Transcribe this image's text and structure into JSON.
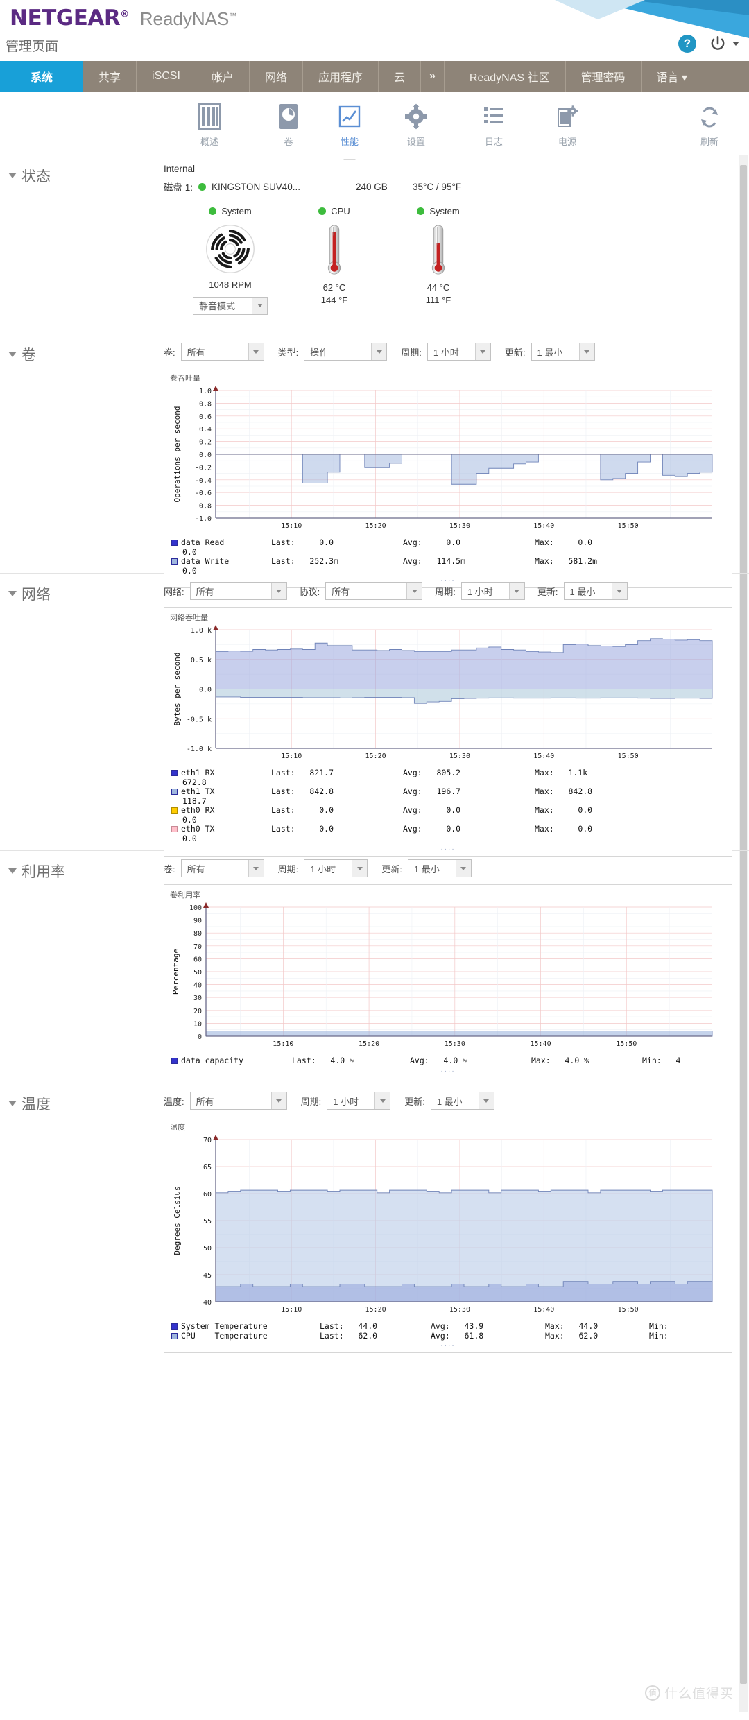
{
  "header": {
    "brand": "NETGEAR",
    "brand_mark": "®",
    "product": "ReadyNAS",
    "product_mark": "™",
    "admin_title": "管理页面",
    "help_icon": "help-icon",
    "help_label": "?",
    "power_icon": "power-icon"
  },
  "tabs": [
    {
      "label": "系统",
      "active": true
    },
    {
      "label": "共享",
      "active": false
    },
    {
      "label": "iSCSI",
      "active": false
    },
    {
      "label": "帐户",
      "active": false
    },
    {
      "label": "网络",
      "active": false
    },
    {
      "label": "应用程序",
      "active": false
    },
    {
      "label": "云",
      "active": false
    },
    {
      "label": "»",
      "active": false
    }
  ],
  "right_tabs": [
    {
      "label": "ReadyNAS 社区"
    },
    {
      "label": "管理密码"
    },
    {
      "label": "语言 ▾"
    }
  ],
  "toolbar": [
    {
      "label": "概述",
      "icon": "overview-icon",
      "active": false
    },
    {
      "label": "卷",
      "icon": "volume-icon",
      "active": false
    },
    {
      "label": "性能",
      "icon": "performance-icon",
      "active": true
    },
    {
      "label": "设置",
      "icon": "settings-gear-icon",
      "active": false
    },
    {
      "label": "日志",
      "icon": "logs-icon",
      "active": false
    },
    {
      "label": "电源",
      "icon": "power-settings-icon",
      "active": false
    },
    {
      "label": "刷新",
      "icon": "refresh-icon",
      "active": false
    }
  ],
  "status": {
    "title": "状态",
    "enclosure": "Internal",
    "disk_label": "磁盘 1:",
    "disk_model": "KINGSTON SUV40...",
    "disk_capacity": "240 GB",
    "disk_temp": "35°C / 95°F",
    "gauges": [
      {
        "name": "System",
        "type": "fan",
        "value": "1048 RPM",
        "value2": "",
        "mode": "靜音模式"
      },
      {
        "name": "CPU",
        "type": "thermo",
        "value": "62 °C",
        "value2": "144 °F"
      },
      {
        "name": "System",
        "type": "thermo",
        "value": "44 °C",
        "value2": "111 °F"
      }
    ]
  },
  "volume": {
    "title": "卷",
    "filters": [
      {
        "label": "卷:",
        "value": "所有"
      },
      {
        "label": "类型:",
        "value": "操作"
      },
      {
        "label": "周期:",
        "value": "1 小时"
      },
      {
        "label": "更新:",
        "value": "1 最小"
      }
    ],
    "panel_title": "卷吞吐量",
    "legend": [
      {
        "name": "data Read",
        "last_label": "Last:",
        "last": "0.0",
        "avg_label": "Avg:",
        "avg": "0.0",
        "max_label": "Max:",
        "max": "0.0",
        "wrap": "0.0",
        "color": "#3333cc"
      },
      {
        "name": "data Write",
        "last_label": "Last:",
        "last": "252.3m",
        "avg_label": "Avg:",
        "avg": "114.5m",
        "max_label": "Max:",
        "max": "581.2m",
        "wrap": "0.0",
        "color": "#9fb6de"
      }
    ]
  },
  "network": {
    "title": "网络",
    "filters": [
      {
        "label": "网络:",
        "value": "所有"
      },
      {
        "label": "协议:",
        "value": "所有"
      },
      {
        "label": "周期:",
        "value": "1 小时"
      },
      {
        "label": "更新:",
        "value": "1 最小"
      }
    ],
    "panel_title": "网络吞吐量",
    "legend": [
      {
        "name": "eth1 RX",
        "last_label": "Last:",
        "last": "821.7",
        "avg_label": "Avg:",
        "avg": "805.2",
        "max_label": "Max:",
        "max": "1.1k",
        "wrap": "672.8",
        "color": "#3333cc"
      },
      {
        "name": "eth1 TX",
        "last_label": "Last:",
        "last": "842.8",
        "avg_label": "Avg:",
        "avg": "196.7",
        "max_label": "Max:",
        "max": "842.8",
        "wrap": "118.7",
        "color": "#9fb6de"
      },
      {
        "name": "eth0 RX",
        "last_label": "Last:",
        "last": "0.0",
        "avg_label": "Avg:",
        "avg": "0.0",
        "max_label": "Max:",
        "max": "0.0",
        "wrap": "0.0",
        "color": "#ffcc00"
      },
      {
        "name": "eth0 TX",
        "last_label": "Last:",
        "last": "0.0",
        "avg_label": "Avg:",
        "avg": "0.0",
        "max_label": "Max:",
        "max": "0.0",
        "wrap": "0.0",
        "color": "#ffc0cb"
      }
    ]
  },
  "utilization": {
    "title": "利用率",
    "filters": [
      {
        "label": "卷:",
        "value": "所有"
      },
      {
        "label": "周期:",
        "value": "1 小时"
      },
      {
        "label": "更新:",
        "value": "1 最小"
      }
    ],
    "panel_title": "卷利用率",
    "legend": [
      {
        "name": "data capacity",
        "last_label": "Last:",
        "last": "4.0 %",
        "avg_label": "Avg:",
        "avg": "4.0 %",
        "max_label": "Max:",
        "max": "4.0 %",
        "min_label": "Min:",
        "min": "4",
        "color": "#3333cc"
      }
    ]
  },
  "temperature": {
    "title": "温度",
    "filters": [
      {
        "label": "温度:",
        "value": "所有"
      },
      {
        "label": "周期:",
        "value": "1 小时"
      },
      {
        "label": "更新:",
        "value": "1 最小"
      }
    ],
    "panel_title": "温度",
    "legend": [
      {
        "name": "System Temperature",
        "last_label": "Last:",
        "last": "44.0",
        "avg_label": "Avg:",
        "avg": "43.9",
        "max_label": "Max:",
        "max": "44.0",
        "min_label": "Min:",
        "min": "",
        "color": "#3333cc"
      },
      {
        "name": "CPU    Temperature",
        "last_label": "Last:",
        "last": "62.0",
        "avg_label": "Avg:",
        "avg": "61.8",
        "max_label": "Max:",
        "max": "62.0",
        "min_label": "Min:",
        "min": "",
        "color": "#9fb6de"
      }
    ]
  },
  "watermark": {
    "mark": "值",
    "text": "什么值得买"
  },
  "chart_data": [
    {
      "id": "volume-throughput",
      "type": "area",
      "title": "卷吞吐量",
      "xlabel": "",
      "ylabel": "Operations per second",
      "ylim": [
        -1.0,
        1.0
      ],
      "yticks": [
        "1.0",
        "0.8",
        "0.6",
        "0.4",
        "0.2",
        "0.0",
        "-0.2",
        "-0.4",
        "-0.6",
        "-0.8",
        "-1.0"
      ],
      "xticks": [
        "15:10",
        "15:20",
        "15:30",
        "15:40",
        "15:50"
      ],
      "grid": true,
      "legend_position": "below",
      "series": [
        {
          "name": "data Read",
          "color": "#3333cc",
          "values": [
            0,
            0,
            0,
            0,
            0,
            0,
            0,
            0,
            0,
            0,
            0,
            0,
            0,
            0,
            0,
            0,
            0,
            0,
            0,
            0,
            0,
            0,
            0,
            0,
            0,
            0,
            0,
            0,
            0,
            0,
            0,
            0,
            0,
            0,
            0,
            0,
            0,
            0,
            0,
            0
          ]
        },
        {
          "name": "data Write",
          "color": "#9fb6de",
          "values": [
            0,
            0,
            0,
            0,
            0,
            0,
            0,
            -0.45,
            -0.45,
            -0.28,
            0,
            0,
            -0.21,
            -0.21,
            -0.14,
            0,
            0,
            0,
            0,
            -0.47,
            -0.47,
            -0.3,
            -0.22,
            -0.22,
            -0.15,
            -0.12,
            0,
            0,
            0,
            0,
            0,
            -0.4,
            -0.38,
            -0.3,
            -0.12,
            0,
            -0.33,
            -0.35,
            -0.3,
            -0.28
          ]
        }
      ]
    },
    {
      "id": "network-throughput",
      "type": "area",
      "title": "网络吞吐量",
      "xlabel": "",
      "ylabel": "Bytes per second",
      "ylim": [
        -1200,
        1200
      ],
      "yticks": [
        "1.0 k",
        "0.5 k",
        "0.0",
        "-0.5 k",
        "-1.0 k"
      ],
      "xticks": [
        "15:10",
        "15:20",
        "15:30",
        "15:40",
        "15:50"
      ],
      "grid": true,
      "legend_position": "below",
      "series": [
        {
          "name": "eth1 RX",
          "color": "#9aa8de",
          "values": [
            760,
            770,
            765,
            800,
            790,
            800,
            810,
            800,
            930,
            880,
            880,
            790,
            790,
            780,
            800,
            780,
            760,
            760,
            760,
            790,
            790,
            830,
            850,
            800,
            790,
            760,
            750,
            740,
            900,
            910,
            880,
            870,
            860,
            900,
            980,
            1020,
            1010,
            990,
            1000,
            980
          ]
        },
        {
          "name": "eth1 TX",
          "color": "#a9c6d8",
          "values": [
            -160,
            -160,
            -170,
            -170,
            -170,
            -170,
            -170,
            -175,
            -175,
            -175,
            -180,
            -175,
            -170,
            -170,
            -170,
            -175,
            -290,
            -260,
            -250,
            -195,
            -190,
            -185,
            -180,
            -180,
            -185,
            -185,
            -185,
            -180,
            -180,
            -185,
            -185,
            -180,
            -180,
            -180,
            -185,
            -190,
            -190,
            -185,
            -185,
            -190
          ]
        },
        {
          "name": "eth0 RX",
          "color": "#ffcc00",
          "values": [
            0,
            0,
            0,
            0,
            0,
            0,
            0,
            0,
            0,
            0,
            0,
            0,
            0,
            0,
            0,
            0,
            0,
            0,
            0,
            0,
            0,
            0,
            0,
            0,
            0,
            0,
            0,
            0,
            0,
            0,
            0,
            0,
            0,
            0,
            0,
            0,
            0,
            0,
            0,
            0
          ]
        },
        {
          "name": "eth0 TX",
          "color": "#ffc0cb",
          "values": [
            0,
            0,
            0,
            0,
            0,
            0,
            0,
            0,
            0,
            0,
            0,
            0,
            0,
            0,
            0,
            0,
            0,
            0,
            0,
            0,
            0,
            0,
            0,
            0,
            0,
            0,
            0,
            0,
            0,
            0,
            0,
            0,
            0,
            0,
            0,
            0,
            0,
            0,
            0,
            0
          ]
        }
      ]
    },
    {
      "id": "volume-utilization",
      "type": "area",
      "title": "卷利用率",
      "xlabel": "",
      "ylabel": "Percentage",
      "ylim": [
        0,
        100
      ],
      "yticks": [
        "100",
        "90",
        "80",
        "70",
        "60",
        "50",
        "40",
        "30",
        "20",
        "10",
        "0"
      ],
      "xticks": [
        "15:10",
        "15:20",
        "15:30",
        "15:40",
        "15:50"
      ],
      "grid": true,
      "legend_position": "below",
      "series": [
        {
          "name": "data capacity",
          "color": "#9fb6de",
          "values": [
            4,
            4,
            4,
            4,
            4,
            4,
            4,
            4,
            4,
            4,
            4,
            4,
            4,
            4,
            4,
            4,
            4,
            4,
            4,
            4,
            4,
            4,
            4,
            4,
            4,
            4,
            4,
            4,
            4,
            4,
            4,
            4,
            4,
            4,
            4,
            4,
            4,
            4,
            4,
            4
          ]
        }
      ]
    },
    {
      "id": "temperature-chart",
      "type": "area",
      "title": "温度",
      "xlabel": "",
      "ylabel": "Degrees Celsius",
      "ylim": [
        40,
        72
      ],
      "yticks": [
        "70",
        "65",
        "60",
        "55",
        "50",
        "45",
        "40"
      ],
      "xticks": [
        "15:10",
        "15:20",
        "15:30",
        "15:40",
        "15:50"
      ],
      "grid": true,
      "legend_position": "below",
      "series": [
        {
          "name": "CPU Temperature",
          "color": "#b9cbe8",
          "values": [
            61.5,
            61.8,
            62,
            62,
            62,
            61.8,
            62,
            62,
            62,
            61.8,
            62,
            62,
            62,
            61.5,
            62,
            62,
            62,
            61.8,
            61.5,
            62,
            62,
            62,
            61.5,
            62,
            62,
            62,
            61.8,
            62,
            62,
            62,
            61.5,
            62,
            62,
            62,
            62,
            61.8,
            62,
            62,
            62,
            62
          ]
        },
        {
          "name": "System Temperature",
          "color": "#9aa8de",
          "values": [
            43,
            43,
            43.5,
            43,
            43,
            43,
            43.5,
            43,
            43,
            43,
            43.5,
            43.5,
            43,
            43,
            43,
            43.5,
            43,
            43,
            43,
            43.5,
            43,
            43,
            43.5,
            43,
            43,
            43.5,
            43,
            43,
            44,
            44,
            43.5,
            43.5,
            44,
            44,
            43.5,
            44,
            44,
            43.5,
            44,
            44
          ]
        }
      ]
    }
  ]
}
